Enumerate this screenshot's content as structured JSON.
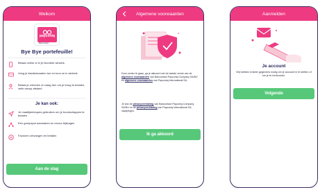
{
  "screens": [
    {
      "header": "Welkom",
      "logo_text": "payconiq",
      "logo_sub": "Bancontact",
      "title": "Bye Bye portefeuille!",
      "features": [
        {
          "icon": "phone-icon",
          "text": "Betaal online of in je favoriete winkels"
        },
        {
          "icon": "card-icon",
          "text": "Voeg je klantenkaarten toe en toon ze in winkels"
        },
        {
          "icon": "person-icon",
          "text": "Betaal je vrienden of vraag hen om je terug te betalen, zelfs vanop afstand"
        }
      ],
      "subtitle": "Je kan ook:",
      "extras": [
        {
          "icon": "send-icon",
          "text": "Je maaltijdcheques gebruiken om je boodschappen te betalen"
        },
        {
          "icon": "group-icon",
          "text": "Een groepspot aanmaken en ervoor bijdragen"
        },
        {
          "icon": "document-icon",
          "text": "Facturen ontvangen en betalen"
        }
      ],
      "button": "Aan de slag"
    },
    {
      "header": "Algemene voorwaarden",
      "para1": {
        "pre": "Door verder te gaan, ga je akkoord met de laatste versie van de ",
        "link1": "algemene voorwaarden",
        "mid1": " van Bancontact Payconiq Company SA/NV en ",
        "link2": "algemene voorwaarden",
        "post": " van Payconiq International SA."
      },
      "para2": {
        "pre": "Je kan de ",
        "link1": "privacyverklaring",
        "mid1": " van Bancontact Payconiq Company SA/NV en de ",
        "link2": "privacyverklaring",
        "post": " van Payconiq International SA raadplegen."
      },
      "button": "Ik ga akkoord"
    },
    {
      "header": "Aanmelden",
      "title": "Je account",
      "text": "Wij hebben enkele gegevens nodig om je account in te stellen of om je te herkennen.",
      "button": "Volgende"
    }
  ],
  "colors": {
    "brand": "#ee3a81",
    "accent_green": "#57c87a",
    "navy": "#2a2a60"
  }
}
